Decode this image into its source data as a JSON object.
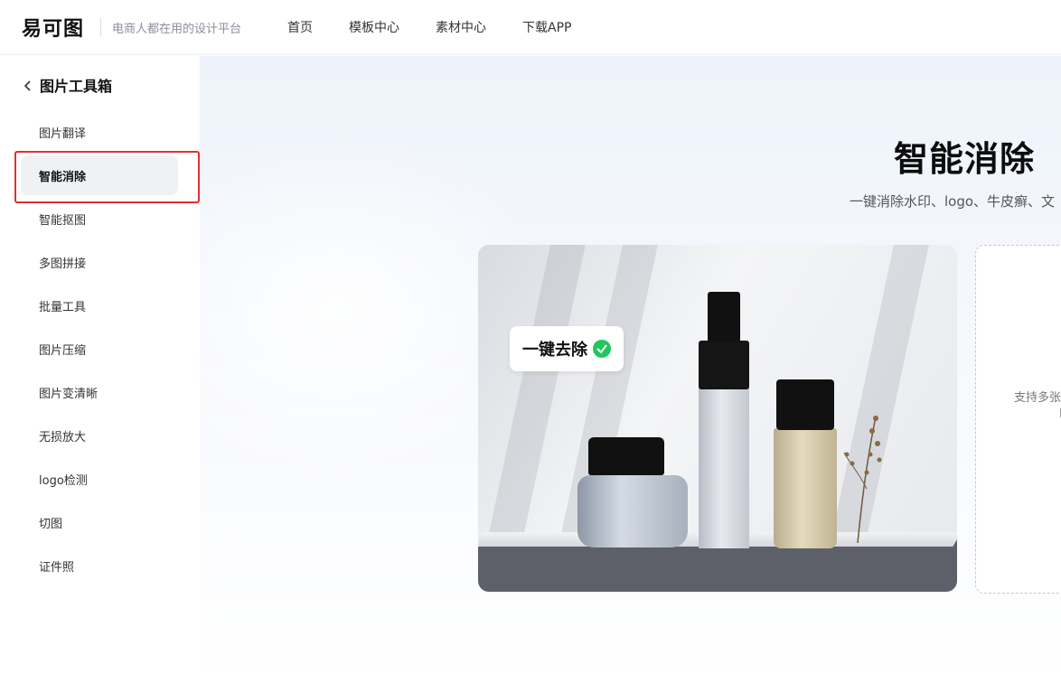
{
  "header": {
    "logo_text": "易可图",
    "slogan": "电商人都在用的设计平台",
    "nav": [
      "首页",
      "模板中心",
      "素材中心",
      "下载APP"
    ]
  },
  "sidebar": {
    "title": "图片工具箱",
    "items": [
      {
        "label": "图片翻译"
      },
      {
        "label": "智能消除",
        "active": true
      },
      {
        "label": "智能抠图"
      },
      {
        "label": "多图拼接"
      },
      {
        "label": "批量工具"
      },
      {
        "label": "图片压缩"
      },
      {
        "label": "图片变清晰"
      },
      {
        "label": "无损放大"
      },
      {
        "label": "logo检测"
      },
      {
        "label": "切图"
      },
      {
        "label": "证件照"
      }
    ]
  },
  "main": {
    "title": "智能消除",
    "subtitle": "一键消除水印、logo、牛皮癣、文",
    "demo_badge": "一键去除",
    "upload_hint_line1": "支持多张",
    "upload_hint_line2": "I"
  },
  "colors": {
    "highlight": "#e03131",
    "check_green": "#22c55e",
    "active_bg": "#eff1f5"
  },
  "icons": {
    "back": "chevron-left-icon",
    "check": "check-circle-icon"
  }
}
